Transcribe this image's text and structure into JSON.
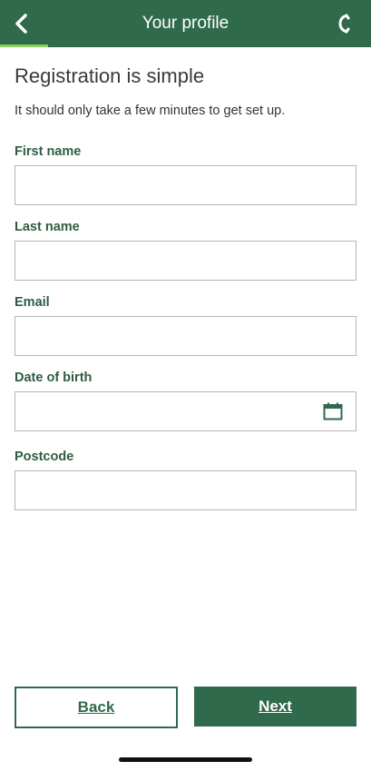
{
  "header": {
    "title": "Your profile",
    "progress_fraction": 0.13
  },
  "main": {
    "heading": "Registration is simple",
    "subtext": "It should only take a few minutes to get set up."
  },
  "fields": {
    "first_name": {
      "label": "First name",
      "value": ""
    },
    "last_name": {
      "label": "Last name",
      "value": ""
    },
    "email": {
      "label": "Email",
      "value": ""
    },
    "dob": {
      "label": "Date of birth",
      "value": ""
    },
    "postcode": {
      "label": "Postcode",
      "value": ""
    }
  },
  "footer": {
    "back_label": "Back",
    "next_label": "Next"
  },
  "colors": {
    "brand_green": "#2f6a4c",
    "progress_green": "#8ccf5a",
    "label_green": "#2f5c43"
  },
  "icons": {
    "back": "chevron-left-icon",
    "call": "phone-icon",
    "calendar": "calendar-icon"
  }
}
